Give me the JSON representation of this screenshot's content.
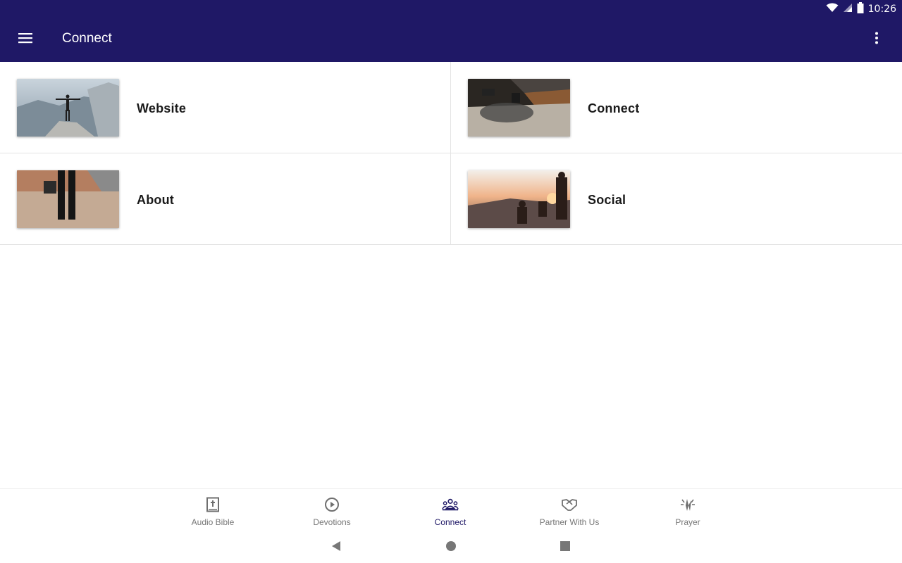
{
  "status": {
    "time": "10:26",
    "icons": [
      "wifi-icon",
      "signal-icon",
      "battery-icon"
    ]
  },
  "appbar": {
    "title": "Connect",
    "menu_icon": "hamburger-menu-icon",
    "overflow_icon": "more-vert-icon",
    "color": "#1f1866"
  },
  "items": [
    {
      "label": "Website",
      "image": "mountain-cliff-person-photo"
    },
    {
      "label": "Connect",
      "image": "coffee-table-interior-photo"
    },
    {
      "label": "About",
      "image": "person-standing-desert-photo"
    },
    {
      "label": "Social",
      "image": "sunset-people-silhouette-photo"
    }
  ],
  "nav": {
    "items": [
      {
        "label": "Audio Bible",
        "icon": "bible-book-icon",
        "active": false
      },
      {
        "label": "Devotions",
        "icon": "play-circle-icon",
        "active": false
      },
      {
        "label": "Connect",
        "icon": "people-group-icon",
        "active": true
      },
      {
        "label": "Partner With Us",
        "icon": "handshake-icon",
        "active": false
      },
      {
        "label": "Prayer",
        "icon": "praying-hands-icon",
        "active": false
      }
    ],
    "active_color": "#1f1866",
    "inactive_color": "#777777"
  },
  "system_nav": [
    "back-icon",
    "home-icon",
    "recents-icon"
  ]
}
